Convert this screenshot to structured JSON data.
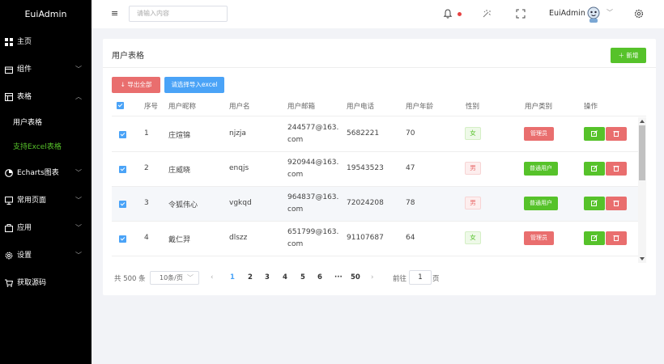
{
  "sidebar": {
    "logo": "EuiAdmin",
    "items": [
      {
        "label": "主页",
        "icon": "grid-icon"
      },
      {
        "label": "组件",
        "icon": "box-icon"
      },
      {
        "label": "表格",
        "icon": "table-icon"
      },
      {
        "label": "Echarts图表",
        "icon": "chart-icon"
      },
      {
        "label": "常用页面",
        "icon": "monitor-icon"
      },
      {
        "label": "应用",
        "icon": "app-icon"
      },
      {
        "label": "设置",
        "icon": "gear-icon"
      },
      {
        "label": "获取源码",
        "icon": "cart-icon"
      }
    ],
    "submenu": [
      "用户表格",
      "支持Excel表格"
    ]
  },
  "header": {
    "search_placeholder": "请输入内容",
    "user_name": "EuiAdmin"
  },
  "card": {
    "title": "用户表格",
    "add_label": "＋ 新增",
    "export_label": "↓ 导出全部",
    "import_label": "请选择导入excel"
  },
  "table": {
    "columns": [
      "序号",
      "用户昵称",
      "用户名",
      "用户邮箱",
      "用户电话",
      "用户年龄",
      "性别",
      "用户类别",
      "操作"
    ],
    "rows": [
      {
        "no": "1",
        "nick": "庄煊锦",
        "user": "njzja",
        "email": "244577@163.com",
        "phone": "5682221",
        "age": "70",
        "gender": "女",
        "type": "管理员"
      },
      {
        "no": "2",
        "nick": "庄威晓",
        "user": "enqjs",
        "email": "920944@163.com",
        "phone": "19543523",
        "age": "47",
        "gender": "男",
        "type": "普通用户"
      },
      {
        "no": "3",
        "nick": "令狐伟心",
        "user": "vgkqd",
        "email": "964837@163.com",
        "phone": "72024208",
        "age": "78",
        "gender": "男",
        "type": "普通用户"
      },
      {
        "no": "4",
        "nick": "戴仁羿",
        "user": "dlszz",
        "email": "651799@163.com",
        "phone": "91107687",
        "age": "64",
        "gender": "女",
        "type": "管理员"
      }
    ]
  },
  "pagination": {
    "total": "共 500 条",
    "page_size": "10条/页",
    "pages": [
      "1",
      "2",
      "3",
      "4",
      "5",
      "6",
      "···",
      "50"
    ],
    "goto_label": "前往",
    "goto_value": "1",
    "unit": "页"
  },
  "colors": {
    "accent_green": "#56c22a",
    "accent_red": "#e96e6e",
    "accent_blue": "#4aa3f7"
  }
}
